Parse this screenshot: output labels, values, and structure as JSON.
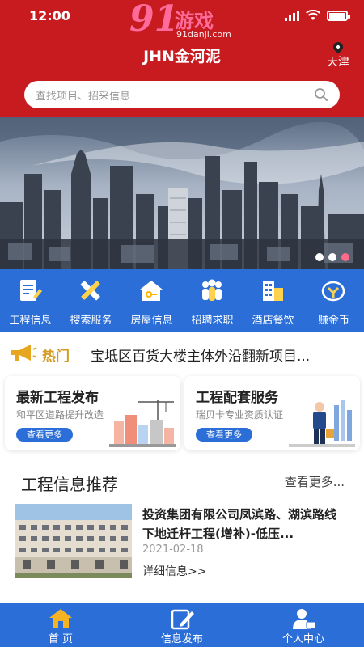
{
  "status_bar": {
    "time": "12:00"
  },
  "watermark": {
    "logo_number": "91",
    "logo_text": "游戏",
    "url": "91danji.com"
  },
  "header": {
    "brand": "JHN金河泥",
    "location": "天津"
  },
  "search": {
    "placeholder": "查找项目、招采信息"
  },
  "banner": {
    "slide_count": 3,
    "active_slide": 3
  },
  "nav": {
    "items": [
      {
        "label": "工程信息",
        "icon": "document-edit-icon"
      },
      {
        "label": "搜索服务",
        "icon": "ruler-pencil-icon"
      },
      {
        "label": "房屋信息",
        "icon": "house-key-icon"
      },
      {
        "label": "招聘求职",
        "icon": "people-group-icon"
      },
      {
        "label": "酒店餐饮",
        "icon": "hotel-building-icon"
      },
      {
        "label": "赚金币",
        "icon": "coin-icon"
      }
    ]
  },
  "hot": {
    "label": "热门",
    "text": "宝坻区百货大楼主体外沿翻新项目..."
  },
  "cards": [
    {
      "title": "最新工程发布",
      "subtitle": "和平区道路提升改造",
      "button": "查看更多"
    },
    {
      "title": "工程配套服务",
      "subtitle": "瑞贝卡专业资质认证",
      "button": "查看更多"
    }
  ],
  "recommend": {
    "title": "工程信息推荐",
    "more": "查看更多...",
    "item": {
      "title": "投资集团有限公司凤滨路、湖滨路线下地迁杆工程(增补)-低压...",
      "date": "2021-02-18",
      "detail": "详细信息>>"
    }
  },
  "tabbar": {
    "tabs": [
      {
        "label": "首 页",
        "icon": "home-icon"
      },
      {
        "label": "信息发布",
        "icon": "publish-edit-icon"
      },
      {
        "label": "个人中心",
        "icon": "user-profile-icon"
      }
    ]
  },
  "colors": {
    "header_red": "#c71b20",
    "nav_blue": "#2b6ed8",
    "hot_gold": "#d39b1f"
  }
}
